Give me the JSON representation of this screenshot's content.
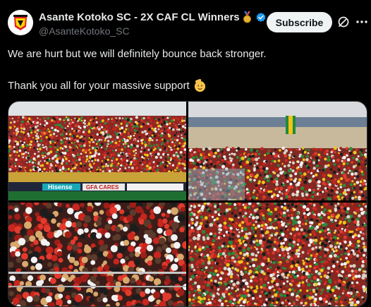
{
  "author": {
    "display_name": "Asante Kotoko SC - 2X CAF CL Winners",
    "handle": "@AsanteKotoko_SC"
  },
  "subscribe_label": "Subscribe",
  "tweet": {
    "line1": "We are hurt but we will definitely bounce back stronger.",
    "line2": "Thank you all for your massive support"
  },
  "photos": {
    "p1": {
      "banner_sponsor": "Hisense",
      "banner_text": "GFA CARES"
    }
  },
  "colors": {
    "background": "#000000",
    "text": "#e7e9ea",
    "muted": "#71767b",
    "verified": "#1d9bf0"
  }
}
